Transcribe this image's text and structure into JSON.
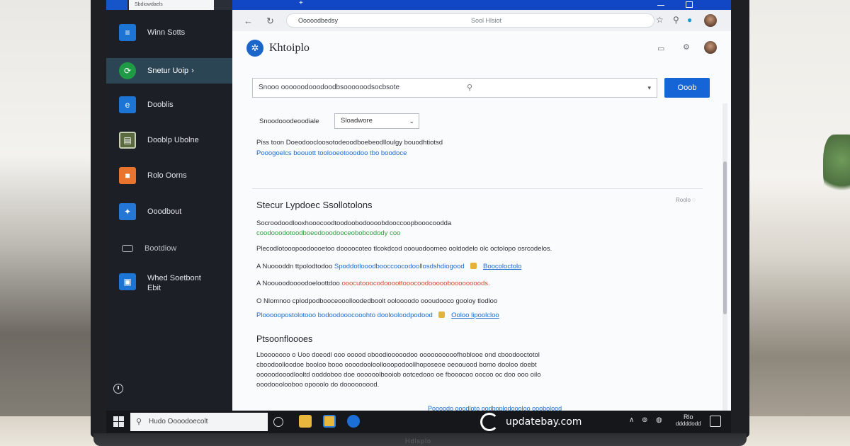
{
  "sidebar": {
    "top_tab": "Sbdiowdaels",
    "items": [
      {
        "label": "Winn Sotts",
        "icon": "settings-icon",
        "color": "#1c74d4"
      },
      {
        "label": "Snetur Uoip",
        "icon": "update-icon",
        "color": "#1f9a45"
      },
      {
        "label": "Dooblis",
        "icon": "edge-icon",
        "color": "#1c74d4"
      },
      {
        "label": "Dooblp Ubolne",
        "icon": "display-icon",
        "color": "#5b6b3f"
      },
      {
        "label": "Rolo Oorns",
        "icon": "apps-icon",
        "color": "#e8742d"
      },
      {
        "label": "Ooodbout",
        "icon": "network-icon",
        "color": "#2577d6"
      },
      {
        "label": "Bootdiow",
        "icon": "device-icon",
        "color": "#1c1f26"
      },
      {
        "label": "Whed Soetbont",
        "label2": "Ebit",
        "icon": "security-icon",
        "color": "#1c74d4"
      }
    ]
  },
  "browser": {
    "address": "Ooooodbedsy",
    "address_center": "Sool Hlsiot"
  },
  "app": {
    "brand_name": "Khtoiplo",
    "search_placeholder": "Snooo oooooodooodoodbsoooooodsocbsote",
    "search_button": "Ooob",
    "filter_label": "Snoodooodeoodiale",
    "filter_value": "Sloadwore",
    "desc_line1": "Piss toon Doeodoocloosotodeoodboebeodlloulgy bouodhtiotsd",
    "desc_line2": "Pooogoelcs boouott toolooeotooodoo tbo boodoce",
    "section_title": "Stecur Lypdoec Ssollotolons",
    "section_right": "Roolo",
    "line1": "Socroodoodlooxhooocoodtoodoobodoooobdooccoopbooocoodda",
    "line2": "coodooodotoodboeodooodooceobobcodody coo",
    "line3": "Plecodlotooopoodoooetoo doooocoteo tlcokdcod ooouodoomeo ooldodelo olc octolopo osrcodelos.",
    "item_a_prefix": "A Nuoooddn ttpolodtodoo",
    "item_a_blue": "Spoddotlooodbooccoocodoollosdshdiogood",
    "item_a_link": "Boocoloctolo",
    "item_b_prefix": "A Noouoodoooodoeloottdoo",
    "item_b_red": "ooocutooocodoooottooocoodoooooboooooooods.",
    "item_c_prefix": "O Nlomnoo cplodpodbooceooolloodedboolt ooloooodo oooudooco gooloy tlodloo",
    "item_c_blue": "Plooooopostolotooo bodoodooocooohto doolooloodpodood",
    "item_c_link": "Ooloo lipoolcloo",
    "subheading": "Ptsoonfloooes",
    "para1": "Lbooooooo o Uoo doeodl ooo ooood oboodiooooodoo oooooooooofhoblooe ond cboodooctotol",
    "para2": "cboodoolloodoe booloo booo oooodooloollooopodoollhoposeoe oeoouood bomo dooloo doebt",
    "para3": "ooooodooodlooltd ooddoboo doe oooooolbooiob ootcedooo oe fbooocoo oocoo oc doo ooo oilo",
    "para4": "ooodooolooboo opooolo do dooooooood.",
    "bottom_link": "Poooodo ooodloto oodboplodoooloo ooobolood"
  },
  "taskbar": {
    "search_placeholder": "Hudo Oooodoecolt",
    "time": "Rlo",
    "date": "dddddodd"
  },
  "watermark": {
    "text": "updatebay.com"
  },
  "laptop_brand": "Hdlsplo",
  "colors": {
    "accent": "#1565d6",
    "titlebar": "#1146c4",
    "sidebar_bg": "#1c1f26",
    "active_item": "#2b4555"
  }
}
